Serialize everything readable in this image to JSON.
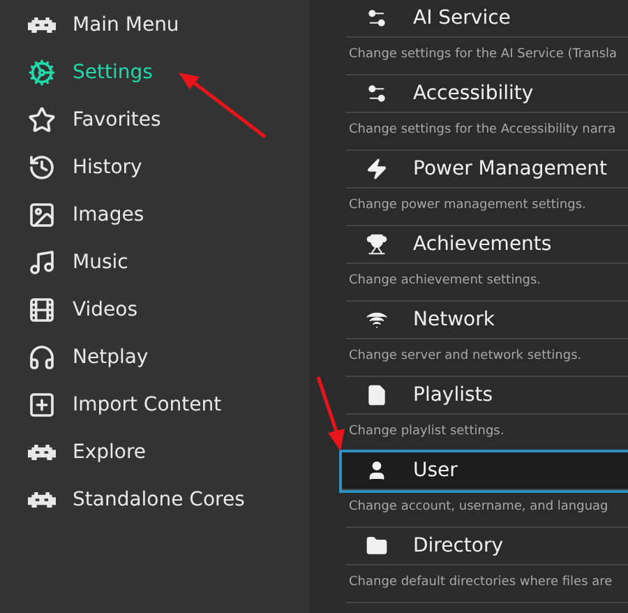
{
  "sidebar": {
    "items": [
      {
        "label": "Main Menu",
        "selected": false
      },
      {
        "label": "Settings",
        "selected": true
      },
      {
        "label": "Favorites",
        "selected": false
      },
      {
        "label": "History",
        "selected": false
      },
      {
        "label": "Images",
        "selected": false
      },
      {
        "label": "Music",
        "selected": false
      },
      {
        "label": "Videos",
        "selected": false
      },
      {
        "label": "Netplay",
        "selected": false
      },
      {
        "label": "Import Content",
        "selected": false
      },
      {
        "label": "Explore",
        "selected": false
      },
      {
        "label": "Standalone Cores",
        "selected": false
      }
    ]
  },
  "settings": {
    "items": [
      {
        "title": "AI Service",
        "description": "Change settings for the AI Service (Transla",
        "selected": false
      },
      {
        "title": "Accessibility",
        "description": "Change settings for the Accessibility narra",
        "selected": false
      },
      {
        "title": "Power Management",
        "description": "Change power management settings.",
        "selected": false
      },
      {
        "title": "Achievements",
        "description": "Change achievement settings.",
        "selected": false
      },
      {
        "title": "Network",
        "description": "Change server and network settings.",
        "selected": false
      },
      {
        "title": "Playlists",
        "description": "Change playlist settings.",
        "selected": false
      },
      {
        "title": "User",
        "description": "Change account, username, and languag",
        "selected": true
      },
      {
        "title": "Directory",
        "description": "Change default directories where files are",
        "selected": false
      }
    ]
  }
}
